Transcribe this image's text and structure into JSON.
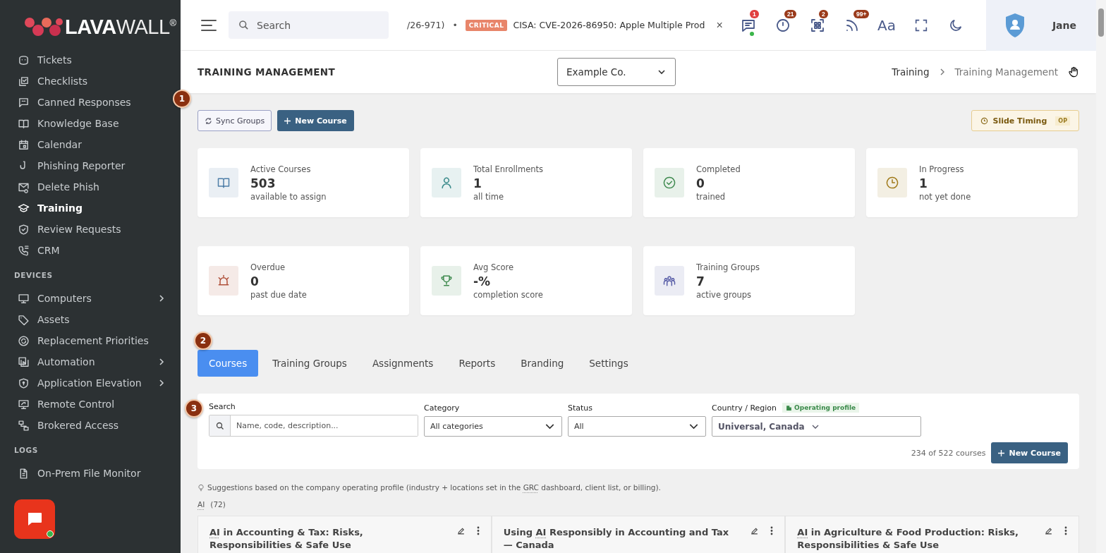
{
  "logo": {
    "bold": "LAVA",
    "light": "WALL",
    "mark": "®"
  },
  "sidebar": [
    {
      "items": [
        {
          "label": "Tickets",
          "selected": false,
          "submenu": false
        },
        {
          "label": "Checklists",
          "selected": false,
          "submenu": false
        },
        {
          "label": "Canned Responses",
          "selected": false,
          "submenu": false
        },
        {
          "label": "Knowledge Base",
          "selected": false,
          "submenu": false
        },
        {
          "label": "Calendar",
          "selected": false,
          "submenu": false
        },
        {
          "label": "Phishing Reporter",
          "selected": false,
          "submenu": false
        },
        {
          "label": "Delete Phish",
          "selected": false,
          "submenu": false
        },
        {
          "label": "Training",
          "selected": true,
          "submenu": false
        },
        {
          "label": "Review Requests",
          "selected": false,
          "submenu": false
        },
        {
          "label": "CRM",
          "selected": false,
          "submenu": false
        }
      ]
    },
    {
      "heading": "DEVICES",
      "items": [
        {
          "label": "Computers",
          "selected": false,
          "submenu": true
        },
        {
          "label": "Assets",
          "selected": false,
          "submenu": false
        },
        {
          "label": "Replacement Priorities",
          "selected": false,
          "submenu": false
        },
        {
          "label": "Automation",
          "selected": false,
          "submenu": true
        },
        {
          "label": "Application Elevation",
          "selected": false,
          "submenu": true
        },
        {
          "label": "Remote Control",
          "selected": false,
          "submenu": false
        },
        {
          "label": "Brokered Access",
          "selected": false,
          "submenu": false
        }
      ]
    },
    {
      "heading": "LOGS",
      "items": [
        {
          "label": "On-Prem File Monitor",
          "selected": false,
          "submenu": false
        }
      ]
    }
  ],
  "topbar": {
    "search": {
      "placeholder": "Search"
    },
    "ticker": {
      "prefix": "/26-971)",
      "separator": "•",
      "severity": "CRITICAL",
      "text": "CISA: CVE-2026-86950: Apple Multiple Prod",
      "close": "×"
    },
    "icons": [
      {
        "badge": "1",
        "online": true
      },
      {
        "badge": "21",
        "online": false
      },
      {
        "badge": "2",
        "online": false
      },
      {
        "badge": "99+",
        "online": false
      }
    ],
    "font_button": "Aa",
    "user": "Jane"
  },
  "page": {
    "title": "TRAINING MANAGEMENT",
    "company": "Example Co.",
    "breadcrumb": [
      "Training",
      "Training Management"
    ]
  },
  "steps": [
    "1",
    "2",
    "3"
  ],
  "actions": {
    "sync": "Sync Groups",
    "new_course": "New Course",
    "slide_timing": "Slide Timing",
    "slide_badge": "OP"
  },
  "stats": [
    {
      "label": "Active Courses",
      "value": "503",
      "sub": "available to assign",
      "color": "#4f7fa8"
    },
    {
      "label": "Total Enrollments",
      "value": "1",
      "sub": "all time",
      "color": "#3a8a8a"
    },
    {
      "label": "Completed",
      "value": "0",
      "sub": "trained",
      "color": "#3f8a4f"
    },
    {
      "label": "In Progress",
      "value": "1",
      "sub": "not yet done",
      "color": "#a07a1a"
    },
    {
      "label": "Overdue",
      "value": "0",
      "sub": "past due date",
      "color": "#b0503a"
    },
    {
      "label": "Avg Score",
      "value": "-%",
      "sub": "completion score",
      "color": "#3f8a4f"
    },
    {
      "label": "Training Groups",
      "value": "7",
      "sub": "active groups",
      "color": "#5a5fa8"
    }
  ],
  "tabs": [
    {
      "label": "Courses",
      "selected": true
    },
    {
      "label": "Training Groups",
      "selected": false
    },
    {
      "label": "Assignments",
      "selected": false
    },
    {
      "label": "Reports",
      "selected": false
    },
    {
      "label": "Branding",
      "selected": false
    },
    {
      "label": "Settings",
      "selected": false
    }
  ],
  "filters": {
    "search": {
      "label": "Search",
      "placeholder": "Name, code, description..."
    },
    "category": {
      "label": "Category",
      "value": "All categories"
    },
    "status": {
      "label": "Status",
      "value": "All"
    },
    "country": {
      "label": "Country / Region",
      "tag": "Operating profile",
      "value": "Universal, Canada"
    },
    "count": "234 of 522 courses",
    "new_course": "New Course"
  },
  "note": {
    "before": "Suggestions based on the company operating profile (industry + locations set in the ",
    "abbr": "GRC",
    "after": " dashboard, client list, or billing)."
  },
  "group": {
    "name": "AI",
    "count": "(72)"
  },
  "courses": [
    {
      "title": [
        {
          "text": "AI",
          "abbr": true
        },
        {
          "text": " in Accounting & Tax: Risks, Responsibilities & Safe Use",
          "abbr": false
        }
      ]
    },
    {
      "title": [
        {
          "text": "Using ",
          "abbr": false
        },
        {
          "text": "AI",
          "abbr": true
        },
        {
          "text": " Responsibly in Accounting and Tax — Canada",
          "abbr": false
        }
      ]
    },
    {
      "title": [
        {
          "text": "AI",
          "abbr": true
        },
        {
          "text": " in Agriculture & Food Production: Risks, Responsibilities & Safe Use",
          "abbr": false
        }
      ]
    }
  ]
}
